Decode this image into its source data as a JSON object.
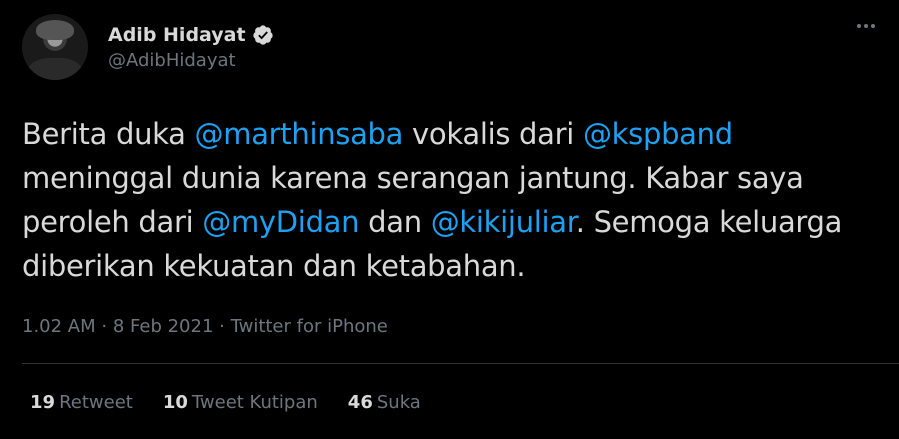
{
  "author": {
    "display_name": "Adib Hidayat",
    "handle": "@AdibHidayat"
  },
  "tweet": {
    "text_1": "Berita duka ",
    "mention_1": "@marthinsaba",
    "text_2": " vokalis dari ",
    "mention_2": "@kspband",
    "text_3": " meninggal dunia karena serangan jantung. Kabar saya peroleh dari ",
    "mention_3": "@myDidan",
    "text_4": " dan ",
    "mention_4": "@kikijuliar",
    "text_5": ". Semoga keluarga diberikan kekuatan dan ketabahan."
  },
  "meta": {
    "time": "1.02 AM",
    "separator_1": " · ",
    "date": "8 Feb 2021",
    "separator_2": " · ",
    "source": "Twitter for iPhone"
  },
  "stats": {
    "retweets_count": "19",
    "retweets_label": "Retweet",
    "quotes_count": "10",
    "quotes_label": "Tweet Kutipan",
    "likes_count": "46",
    "likes_label": "Suka"
  },
  "colors": {
    "background": "#000000",
    "text": "#d9d9d9",
    "secondary": "#6e767d",
    "mention": "#1da1f2",
    "divider": "#2f3336"
  },
  "icons": {
    "verified": "verified-badge-icon",
    "more": "more-options-icon"
  }
}
